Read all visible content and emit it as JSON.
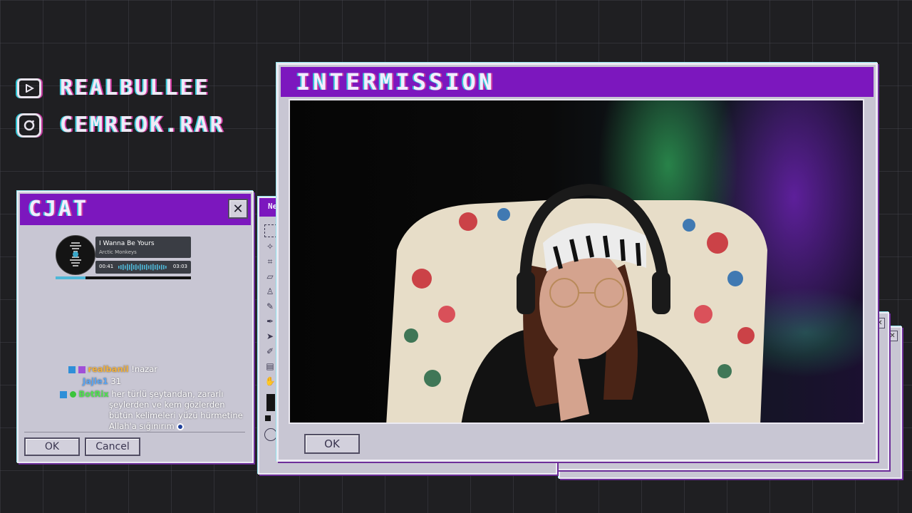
{
  "socials": {
    "youtube_handle": "REALBULLEE",
    "instagram_handle": "CEMREOK.RAR"
  },
  "chat_window": {
    "title": "CJAT",
    "close_glyph": "✕",
    "ok_label": "OK",
    "cancel_label": "Cancel"
  },
  "now_playing": {
    "track": "I Wanna Be Yours",
    "artist": "Arctic Monkeys",
    "elapsed": "00:41",
    "duration": "03:03",
    "progress": 0.22
  },
  "chat": {
    "messages": [
      {
        "user": "realbanil",
        "text": "!nazar"
      },
      {
        "user": "Jajle1",
        "text": "31"
      },
      {
        "user": "BotRix",
        "lines": [
          "her türlü şeytandan, zararlı",
          "şeylerden ve kem gözlerden",
          "bütün kelimeleri yüzü hürmetine",
          "Allah'a sığınırım"
        ]
      }
    ]
  },
  "back_window": {
    "title_fragment": "Ne"
  },
  "main_window": {
    "title": "INTERMISSION",
    "ok_label": "OK"
  },
  "colors": {
    "accent_purple": "#7c17be",
    "window_face": "#c8c6d3",
    "glitch_cyan": "#35c8da",
    "glitch_magenta": "#d0389e"
  }
}
